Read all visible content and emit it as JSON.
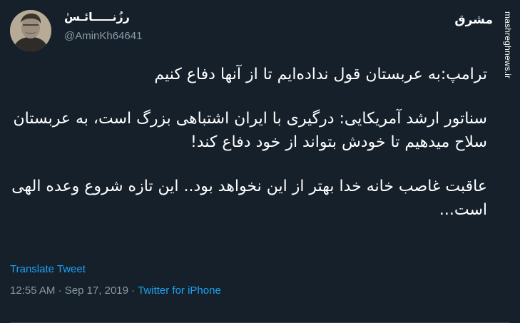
{
  "author": {
    "display_name": "رزُنـــــائـسٰ",
    "handle": "@AminKh64641"
  },
  "watermark": {
    "logo_text": "مشرق",
    "site_text": "mashreghnews.ir"
  },
  "tweet": {
    "paragraphs": [
      "ترامپ:به عربستان قول نداده‌ایم تا از آنها دفاع کنیم",
      "سناتور ارشد آمریکایی: درگیری با ایران اشتباهی بزرگ است، به عربستان سلاح میدهیم تا خودش بتواند از خود دفاع کند!",
      "عاقبت غاصب خانه خدا بهتر از این نخواهد بود.. این تازه شروع وعده الهی است..."
    ],
    "translate_label": "Translate Tweet",
    "time": "12:55 AM",
    "date": "Sep 17, 2019",
    "separator": "·",
    "source": "Twitter for iPhone"
  },
  "colors": {
    "background": "#15202b",
    "accent": "#1da1f2",
    "secondary_text": "#8899a6"
  }
}
